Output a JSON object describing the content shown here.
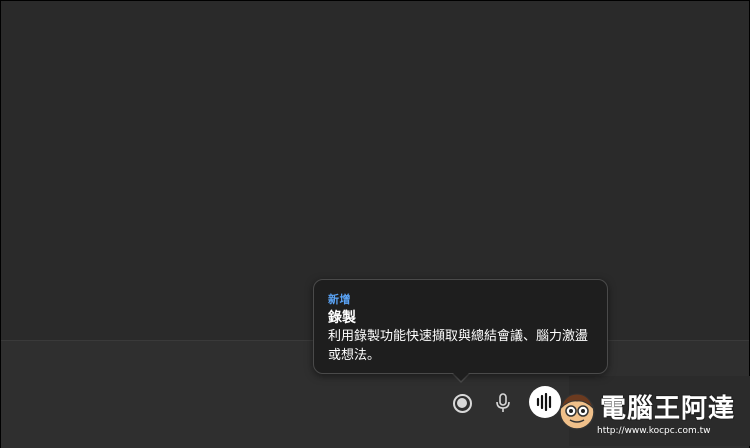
{
  "tooltip": {
    "badge": "新增",
    "title": "錄製",
    "body": "利用錄製功能快速擷取與總結會議、腦力激盪或想法。"
  },
  "toolbar": {
    "record_icon": "record-icon",
    "mic_icon": "microphone-icon",
    "voice_icon": "voice-waveform-icon"
  },
  "watermark": {
    "brand": "電腦王阿達",
    "url": "http://www.kocpc.com.tw"
  },
  "colors": {
    "background": "#2a2a2a",
    "tooltip_bg": "#1e1e1e",
    "badge": "#5aa3f5"
  }
}
